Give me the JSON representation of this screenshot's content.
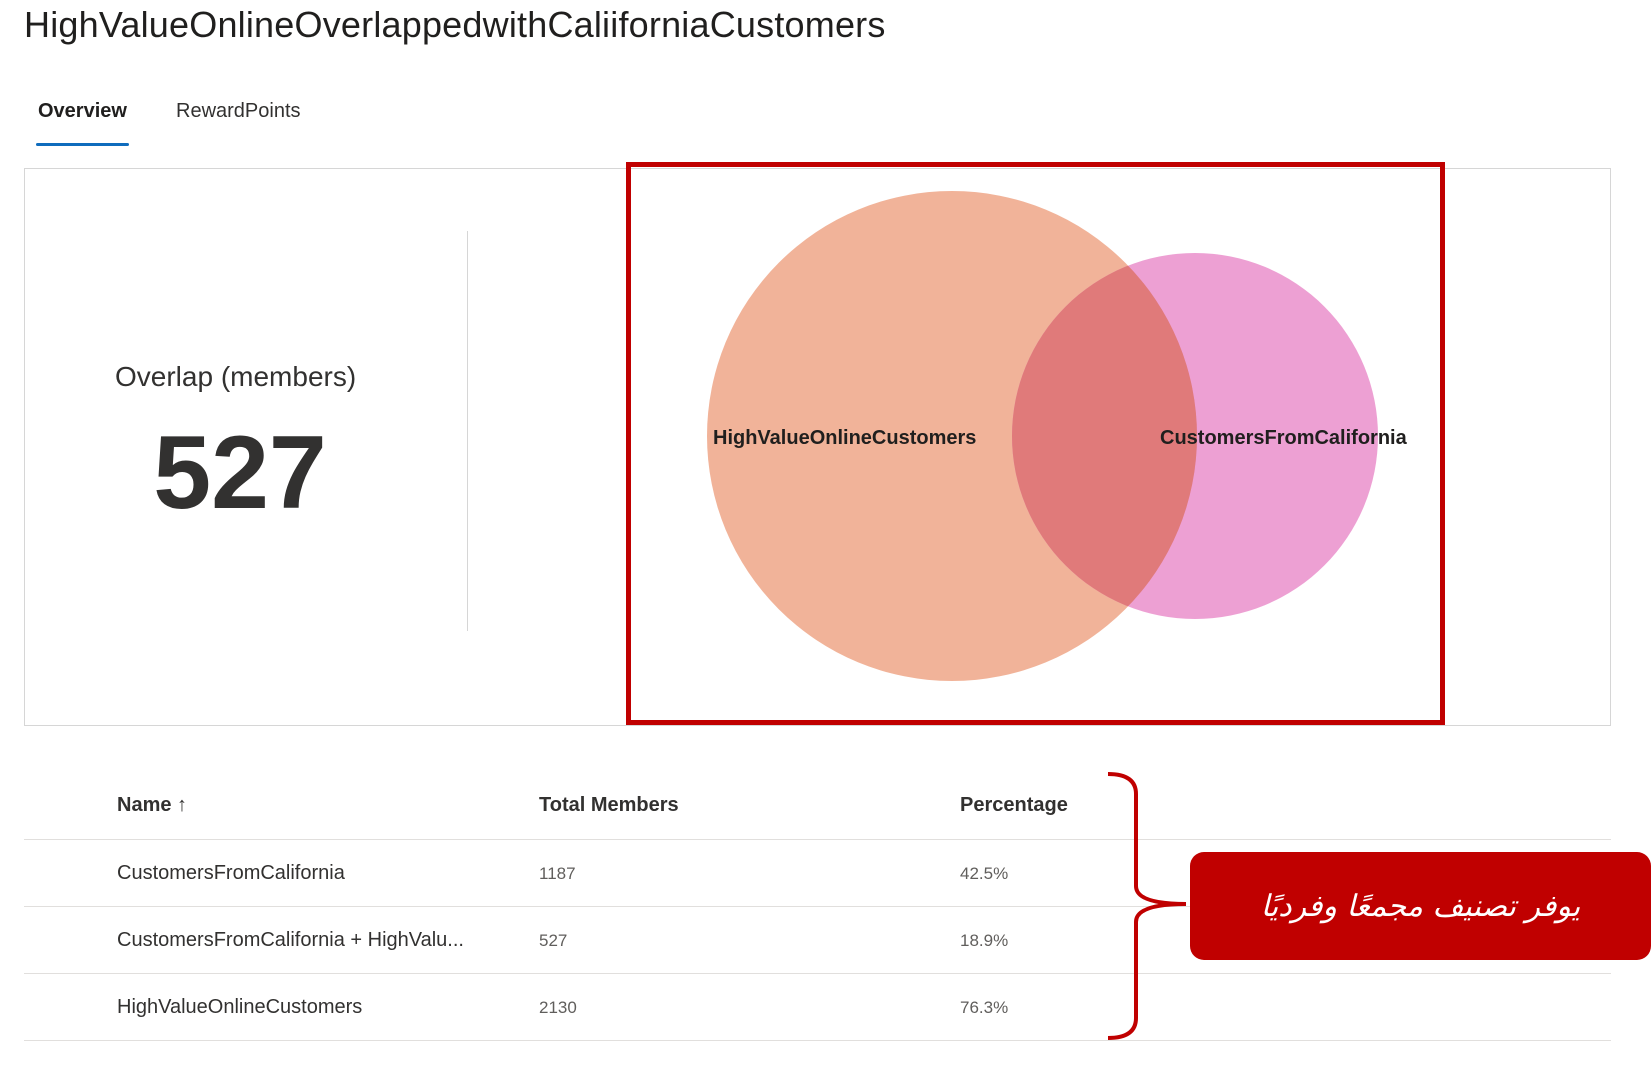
{
  "page": {
    "title": "HighValueOnlineOverlappedwithCaliiforniaCustomers"
  },
  "tabs": [
    {
      "label": "Overview",
      "active": true
    },
    {
      "label": "RewardPoints",
      "active": false
    }
  ],
  "overview": {
    "overlap_label": "Overlap (members)",
    "overlap_value": "527"
  },
  "venn": {
    "sets": [
      {
        "name": "HighValueOnlineCustomers",
        "color": "#eda080"
      },
      {
        "name": "CustomersFromCalifornia",
        "color": "#e888c8"
      }
    ],
    "intersection_color": "#e07a7a"
  },
  "table": {
    "headers": {
      "name": "Name ↑",
      "total": "Total Members",
      "pct": "Percentage"
    },
    "rows": [
      {
        "name": "CustomersFromCalifornia",
        "total": "1187",
        "pct": "42.5%"
      },
      {
        "name": "CustomersFromCalifornia + HighValu...",
        "total": "527",
        "pct": "18.9%"
      },
      {
        "name": "HighValueOnlineCustomers",
        "total": "2130",
        "pct": "76.3%"
      }
    ]
  },
  "annotation": {
    "callout_text": "يوفر تصنيف مجمعًا وفرديًا",
    "color": "#c00000"
  }
}
